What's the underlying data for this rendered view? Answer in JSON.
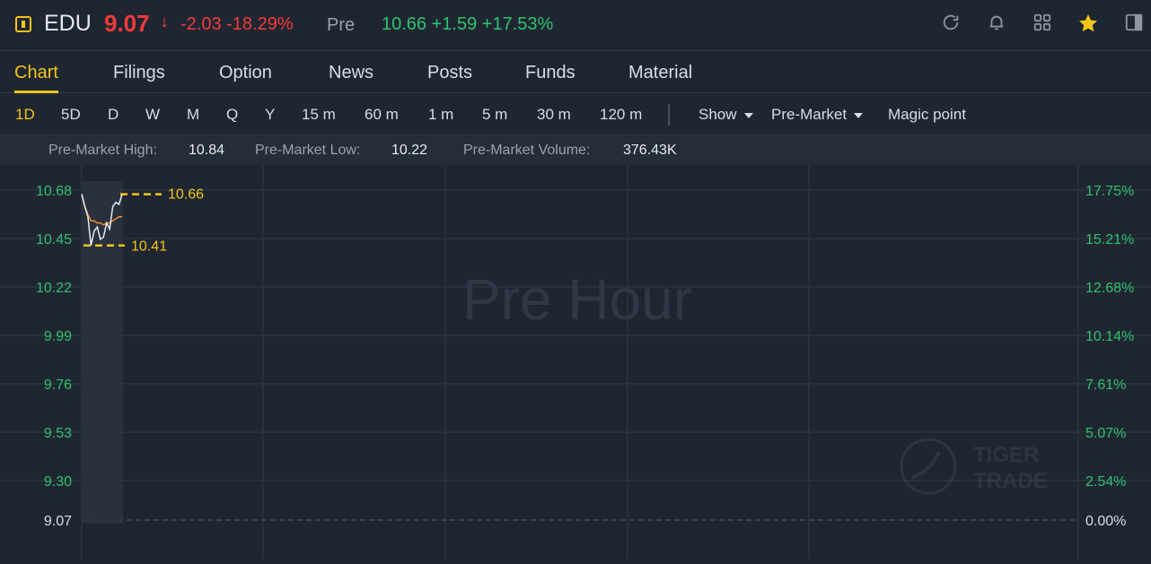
{
  "header": {
    "ticker": "EDU",
    "last_price": "9.07",
    "change": "-2.03 -18.29%",
    "session_label": "Pre",
    "pre_price": "10.66 +1.59 +17.53%",
    "icons": [
      "market-status-icon",
      "refresh-icon",
      "bell-icon",
      "grid-icon",
      "star-icon",
      "sidebar-toggle-icon"
    ],
    "colors": {
      "down": "#f23a3a",
      "up": "#2fc36c",
      "accent": "#f4c518"
    }
  },
  "tabs": [
    {
      "label": "Chart",
      "active": true
    },
    {
      "label": "Filings"
    },
    {
      "label": "Option"
    },
    {
      "label": "News"
    },
    {
      "label": "Posts"
    },
    {
      "label": "Funds"
    },
    {
      "label": "Material"
    }
  ],
  "periods": [
    "1D",
    "5D",
    "D",
    "W",
    "M",
    "Q",
    "Y",
    "15 m",
    "60 m",
    "1 m",
    "5 m",
    "30 m",
    "120 m"
  ],
  "active_period": "1D",
  "toolbar": {
    "show_label": "Show",
    "session_select": "Pre-Market",
    "magic_point": "Magic point"
  },
  "stats": {
    "high_label": "Pre-Market High:",
    "high_value": "10.84",
    "low_label": "Pre-Market Low:",
    "low_value": "10.22",
    "volume_label": "Pre-Market Volume:",
    "volume_value": "376.43K"
  },
  "chart": {
    "watermark": "Pre Hour",
    "brand_line1": "TIGER",
    "brand_line2": "TRADE",
    "high_marker": "10.66",
    "low_marker": "10.41"
  },
  "chart_data": {
    "type": "line",
    "y_ticks_left": [
      "10.68",
      "10.45",
      "10.22",
      "9.99",
      "9.76",
      "9.53",
      "9.30",
      "9.07"
    ],
    "y_ticks_right": [
      "17.75%",
      "15.21%",
      "12.68%",
      "10.14%",
      "7.61%",
      "5.07%",
      "2.54%",
      "0.00%"
    ],
    "ylim": [
      9.07,
      10.68
    ],
    "reference_close": 9.07,
    "price_series": [
      10.66,
      10.6,
      10.55,
      10.41,
      10.48,
      10.5,
      10.44,
      10.45,
      10.52,
      10.49,
      10.6,
      10.62,
      10.61,
      10.66
    ],
    "avg_series": [
      10.66,
      10.6,
      10.56,
      10.53,
      10.53,
      10.52,
      10.52,
      10.51,
      10.52,
      10.52,
      10.53,
      10.54,
      10.55,
      10.55
    ],
    "colors": {
      "price": "#e8eaee",
      "avg": "#f08a2b",
      "marker": "#f4c518",
      "axis_left": "#2fc36c",
      "axis_right": "#2fc36c"
    }
  }
}
